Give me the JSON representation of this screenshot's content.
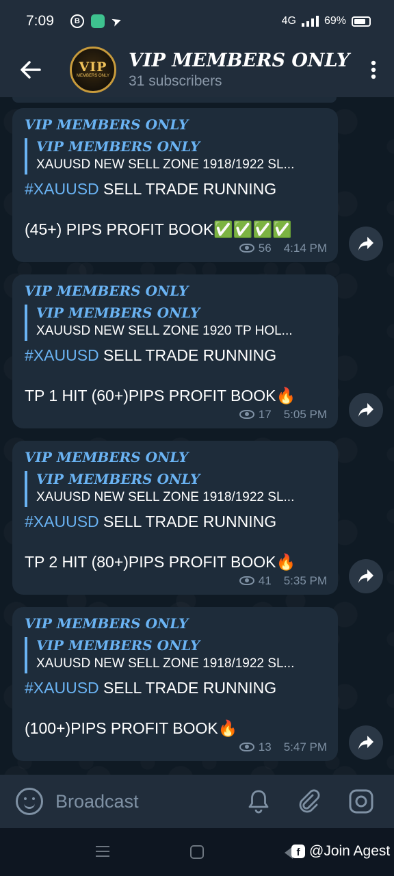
{
  "status_bar": {
    "time": "7:09",
    "network": "4G",
    "battery": "69%",
    "icons": [
      "b-circle-icon",
      "app-icon",
      "send-icon"
    ]
  },
  "header": {
    "title": "VIP MEMBERS ONLY",
    "subtitle": "31 subscribers",
    "avatar_text": "VIP",
    "avatar_sub": "MEMBERS ONLY"
  },
  "messages": [
    {
      "author": "VIP MEMBERS ONLY",
      "reply_author": "VIP MEMBERS ONLY",
      "reply_text": "XAUUSD NEW SELL ZONE 1918/1922  SL...",
      "hashtag": "#XAUUSD",
      "line1_rest": " SELL TRADE RUNNING",
      "line2": "(45+) PIPS PROFIT BOOK✅✅✅✅",
      "views": "56",
      "time": "4:14 PM"
    },
    {
      "author": "VIP MEMBERS ONLY",
      "reply_author": "VIP MEMBERS ONLY",
      "reply_text": "XAUUSD NEW SELL ZONE 1920  TP  HOL...",
      "hashtag": "#XAUUSD",
      "line1_rest": "  SELL TRADE RUNNING",
      "line2": "TP 1 HIT (60+)PIPS PROFIT BOOK🔥",
      "views": "17",
      "time": "5:05 PM"
    },
    {
      "author": "VIP MEMBERS ONLY",
      "reply_author": "VIP MEMBERS ONLY",
      "reply_text": "XAUUSD NEW SELL ZONE 1918/1922  SL...",
      "hashtag": "#XAUUSD",
      "line1_rest": "  SELL TRADE RUNNING",
      "line2": "TP 2 HIT (80+)PIPS PROFIT BOOK🔥",
      "views": "41",
      "time": "5:35 PM"
    },
    {
      "author": "VIP MEMBERS ONLY",
      "reply_author": "VIP MEMBERS ONLY",
      "reply_text": "XAUUSD NEW SELL ZONE 1918/1922  SL...",
      "hashtag": "#XAUUSD",
      "line1_rest": "  SELL TRADE RUNNING",
      "line2": "(100+)PIPS PROFIT BOOK🔥",
      "views": "13",
      "time": "5:47 PM"
    }
  ],
  "input": {
    "placeholder": "Broadcast"
  },
  "watermark": {
    "text": "@Join Agest"
  },
  "colors": {
    "accent": "#6ab3f3",
    "bubble": "#1e2c3a",
    "header": "#212d3b",
    "muted": "#7f91a4"
  }
}
